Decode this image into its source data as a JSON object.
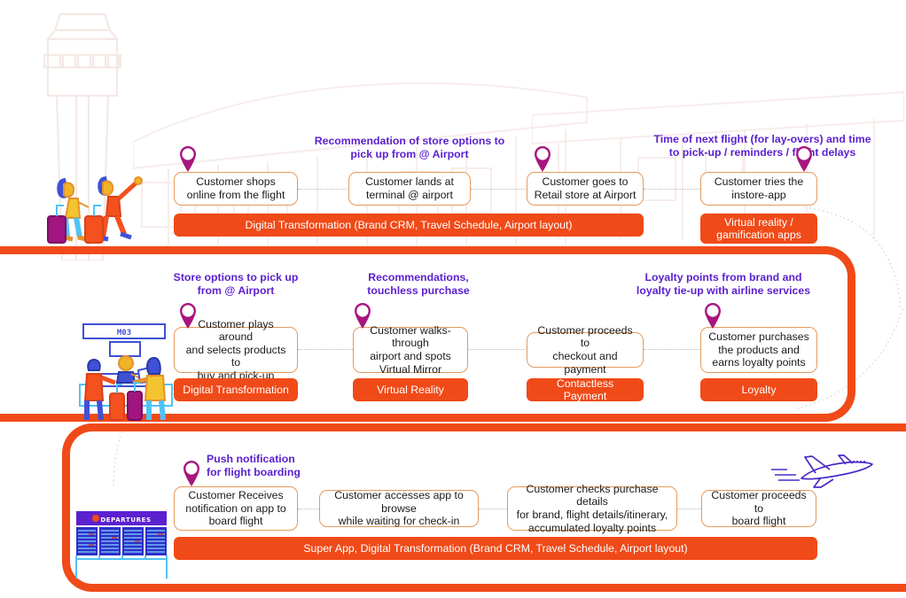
{
  "theme": {
    "orange": "#F04A18",
    "purple_note": "#5B21CF",
    "pin_magenta": "#A8157F",
    "box_border": "#E59A5C",
    "connector_gray": "#b9b9b9",
    "plane_purple": "#4B2AC6"
  },
  "icons": {
    "pin": "map-pin-icon",
    "plane": "airplane-icon",
    "tower": "control-tower-watermark",
    "terminal": "terminal-building-watermark"
  },
  "bands": [
    {
      "id": "band-1",
      "name": "pre-arrival-and-arrival",
      "steps": [
        {
          "text": "Customer shops\nonline from the flight"
        },
        {
          "text": "Customer lands at\nterminal @ airport"
        },
        {
          "text": "Customer goes to\nRetail store at Airport"
        },
        {
          "text": "Customer tries the\ninstore-app"
        }
      ],
      "pills": [
        {
          "text": "Digital Transformation (Brand CRM, Travel Schedule, Airport layout)"
        },
        {
          "text": "Virtual reality /\ngamification apps"
        }
      ],
      "notes": [
        {
          "text": "Recommendation of store options to\npick up from @ Airport"
        },
        {
          "text": "Time of next flight (for lay-overs) and time\nto pick-up / reminders / flight delays"
        }
      ],
      "illustration": "two-travellers-with-luggage"
    },
    {
      "id": "band-2",
      "name": "in-store-shopping",
      "steps": [
        {
          "text": "Customer plays around\nand selects products to\nbuy and pick-up"
        },
        {
          "text": "Customer walks-through\nairport and spots\nVirtual Mirror"
        },
        {
          "text": "Customer proceeds to\ncheckout and payment"
        },
        {
          "text": "Customer purchases\nthe products and\nearns loyalty points"
        }
      ],
      "pills": [
        {
          "text": "Digital Transformation"
        },
        {
          "text": "Virtual Reality"
        },
        {
          "text": "Contactless Payment"
        },
        {
          "text": "Loyalty"
        }
      ],
      "notes": [
        {
          "text": "Store options to pick up\nfrom @ Airport"
        },
        {
          "text": "Recommendations,\ntouchless purchase"
        },
        {
          "text": "Loyalty points from brand and\nloyalty tie-up with airline services"
        }
      ],
      "illustration": "check-in-counter-scene",
      "illustration_sign": "M03"
    },
    {
      "id": "band-3",
      "name": "boarding",
      "steps": [
        {
          "text": "Customer Receives\nnotification on app to\nboard flight"
        },
        {
          "text": "Customer accesses app to browse\nwhile waiting for check-in"
        },
        {
          "text": "Customer checks purchase details\nfor brand, flight details/itinerary,\naccumulated loyalty points"
        },
        {
          "text": "Customer proceeds to\nboard flight"
        }
      ],
      "pills": [
        {
          "text": "Super App, Digital Transformation (Brand CRM, Travel Schedule, Airport layout)"
        }
      ],
      "notes": [
        {
          "text": "Push notification\nfor flight boarding"
        }
      ],
      "illustration": "departures-board",
      "illustration_label": "DEPARTURES"
    }
  ]
}
